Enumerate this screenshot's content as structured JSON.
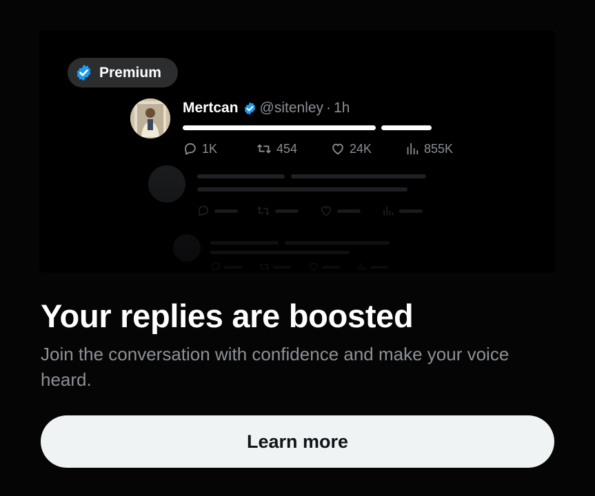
{
  "badge": {
    "label": "Premium",
    "icon": "verified-badge-icon",
    "color": "#1d9bf0"
  },
  "tweet": {
    "name": "Mertcan",
    "handle": "@sitenley",
    "separator": "·",
    "time": "1h",
    "stats": {
      "replies": "1K",
      "reposts": "454",
      "likes": "24K",
      "views": "855K"
    }
  },
  "headline": "Your replies are boosted",
  "subtitle": "Join the conversation with confidence and make your voice heard.",
  "cta": {
    "label": "Learn more"
  },
  "colors": {
    "background": "#050505",
    "verified": "#1d9bf0",
    "button_bg": "#eff3f4",
    "muted_text": "#8d9196"
  }
}
